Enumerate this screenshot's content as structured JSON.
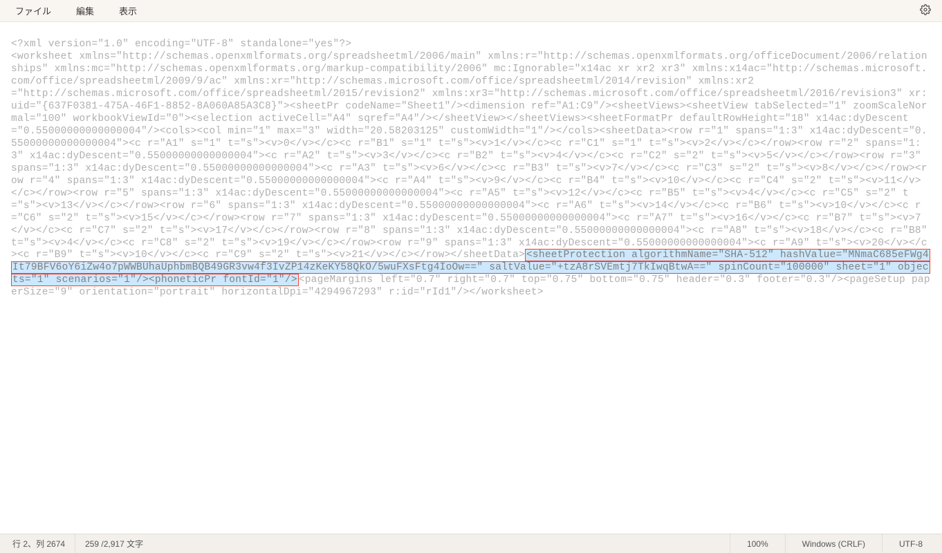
{
  "menu": {
    "file": "ファイル",
    "edit": "編集",
    "view": "表示"
  },
  "text": {
    "before": "<?xml version=\"1.0\" encoding=\"UTF-8\" standalone=\"yes\"?>\n<worksheet xmlns=\"http://schemas.openxmlformats.org/spreadsheetml/2006/main\" xmlns:r=\"http://schemas.openxmlformats.org/officeDocument/2006/relationships\" xmlns:mc=\"http://schemas.openxmlformats.org/markup-compatibility/2006\" mc:Ignorable=\"x14ac xr xr2 xr3\" xmlns:x14ac=\"http://schemas.microsoft.com/office/spreadsheetml/2009/9/ac\" xmlns:xr=\"http://schemas.microsoft.com/office/spreadsheetml/2014/revision\" xmlns:xr2\n=\"http://schemas.microsoft.com/office/spreadsheetml/2015/revision2\" xmlns:xr3=\"http://schemas.microsoft.com/office/spreadsheetml/2016/revision3\" xr:uid=\"{637F0381-475A-46F1-8852-8A060A85A3C8}\"><sheetPr codeName=\"Sheet1\"/><dimension ref=\"A1:C9\"/><sheetViews><sheetView tabSelected=\"1\" zoomScaleNormal=\"100\" workbookViewId=\"0\"><selection activeCell=\"A4\" sqref=\"A4\"/></sheetView></sheetViews><sheetFormatPr defaultRowHeight=\"18\" x14ac:dyDescent=\"0.55000000000000004\"/><cols><col min=\"1\" max=\"3\" width=\"20.58203125\" customWidth=\"1\"/></cols><sheetData><row r=\"1\" spans=\"1:3\" x14ac:dyDescent=\"0.55000000000000004\"><c r=\"A1\" s=\"1\" t=\"s\"><v>0</v></c><c r=\"B1\" s=\"1\" t=\"s\"><v>1</v></c><c r=\"C1\" s=\"1\" t=\"s\"><v>2</v></c></row><row r=\"2\" spans=\"1:3\" x14ac:dyDescent=\"0.55000000000000004\"><c r=\"A2\" t=\"s\"><v>3</v></c><c r=\"B2\" t=\"s\"><v>4</v></c><c r=\"C2\" s=\"2\" t=\"s\"><v>5</v></c></row><row r=\"3\" spans=\"1:3\" x14ac:dyDescent=\"0.55000000000000004\"><c r=\"A3\" t=\"s\"><v>6</v></c><c r=\"B3\" t=\"s\"><v>7</v></c><c r=\"C3\" s=\"2\" t=\"s\"><v>8</v></c></row><row r=\"4\" spans=\"1:3\" x14ac:dyDescent=\"0.55000000000000004\"><c r=\"A4\" t=\"s\"><v>9</v></c><c r=\"B4\" t=\"s\"><v>10</v></c><c r=\"C4\" s=\"2\" t=\"s\"><v>11</v></c></row><row r=\"5\" spans=\"1:3\" x14ac:dyDescent=\"0.55000000000000004\"><c r=\"A5\" t=\"s\"><v>12</v></c><c r=\"B5\" t=\"s\"><v>4</v></c><c r=\"C5\" s=\"2\" t=\"s\"><v>13</v></c></row><row r=\"6\" spans=\"1:3\" x14ac:dyDescent=\"0.55000000000000004\"><c r=\"A6\" t=\"s\"><v>14</v></c><c r=\"B6\" t=\"s\"><v>10</v></c><c r=\"C6\" s=\"2\" t=\"s\"><v>15</v></c></row><row r=\"7\" spans=\"1:3\" x14ac:dyDescent=\"0.55000000000000004\"><c r=\"A7\" t=\"s\"><v>16</v></c><c r=\"B7\" t=\"s\"><v>7</v></c><c r=\"C7\" s=\"2\" t=\"s\"><v>17</v></c></row><row r=\"8\" spans=\"1:3\" x14ac:dyDescent=\"0.55000000000000004\"><c r=\"A8\" t=\"s\"><v>18</v></c><c r=\"B8\" t=\"s\"><v>4</v></c><c r=\"C8\" s=\"2\" t=\"s\"><v>19</v></c></row><row r=\"9\" spans=\"1:3\" x14ac:dyDescent=\"0.55000000000000004\"><c r=\"A9\" t=\"s\"><v>20</v></c><c r=\"B9\" t=\"s\"><v>10</v></c><c r=\"C9\" s=\"2\" t=\"s\"><v>21</v></c></row></sheetData>",
    "highlight": "<sheetProtection algorithmName=\"SHA-512\" hashValue=\"MNmaC685eFWg4It79BFV6oY6iZw4o7pWWBUhaUphbmBQB49GR3vw4f3IvZP14zKeKY58QkO/5wuFXsFtg4IoOw==\" saltValue=\"+tzA8rSVEmtj7TkIwqBtwA==\" spinCount=\"100000\" sheet=\"1\" objects=\"1\" scenarios=\"1\"/><phoneticPr fontId=\"1\"/>",
    "after": "<pageMargins left=\"0.7\" right=\"0.7\" top=\"0.75\" bottom=\"0.75\" header=\"0.3\" footer=\"0.3\"/><pageSetup paperSize=\"9\" orientation=\"portrait\" horizontalDpi=\"4294967293\" r:id=\"rId1\"/></worksheet>"
  },
  "status": {
    "cursor": "行 2、列 2674",
    "chars": "259 /2,917 文字",
    "zoom": "100%",
    "eol": "Windows (CRLF)",
    "encoding": "UTF-8"
  }
}
